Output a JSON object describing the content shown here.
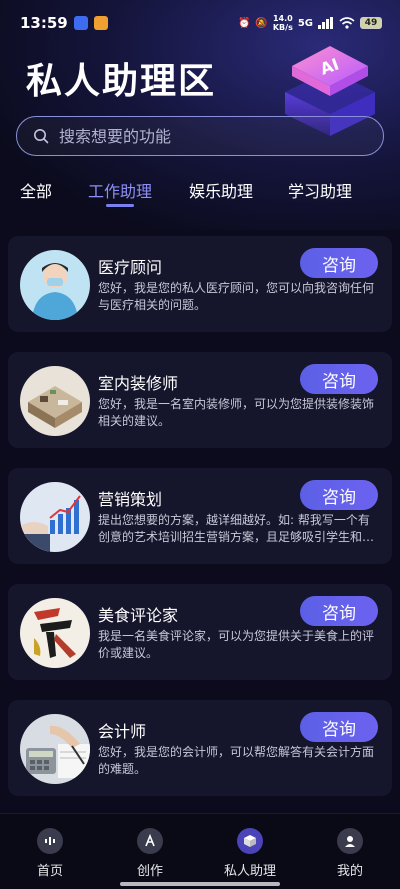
{
  "status_bar": {
    "time": "13:59",
    "net_speed_value": "14.0",
    "net_speed_unit": "KB/s",
    "signal": "5G",
    "battery": "49"
  },
  "header": {
    "title": "私人助理区",
    "ai_badge": "AI"
  },
  "search": {
    "placeholder": "搜索想要的功能"
  },
  "tabs": [
    {
      "label": "全部",
      "active": false
    },
    {
      "label": "工作助理",
      "active": true
    },
    {
      "label": "娱乐助理",
      "active": false
    },
    {
      "label": "学习助理",
      "active": false
    }
  ],
  "assistants": [
    {
      "title": "医疗顾问",
      "desc": "您好，我是您的私人医疗顾问，您可以向我咨询任何与医疗相关的问题。",
      "button": "咨询"
    },
    {
      "title": "室内装修师",
      "desc": "您好，我是一名室内装修师，可以为您提供装修装饰相关的建议。",
      "button": "咨询"
    },
    {
      "title": "营销策划",
      "desc": "提出您想要的方案，越详细越好。如: 帮我写一个有创意的艺术培训招生营销方案，且足够吸引学生和家长",
      "button": "咨询"
    },
    {
      "title": "美食评论家",
      "desc": "我是一名美食评论家，可以为您提供关于美食上的评价或建议。",
      "button": "咨询"
    },
    {
      "title": "会计师",
      "desc": "您好，我是您的会计师，可以帮您解答有关会计方面的难题。",
      "button": "咨询"
    }
  ],
  "bottom_nav": [
    {
      "label": "首页",
      "icon": "home-waveform-icon",
      "active": false
    },
    {
      "label": "创作",
      "icon": "create-a-icon",
      "active": false
    },
    {
      "label": "私人助理",
      "icon": "assistant-cube-icon",
      "active": true
    },
    {
      "label": "我的",
      "icon": "profile-icon",
      "active": false
    }
  ],
  "colors": {
    "accent": "#6c63f0",
    "active_tab": "#8d8ff5",
    "card_bg": "#15152c",
    "page_bg": "#0b0b1d"
  }
}
